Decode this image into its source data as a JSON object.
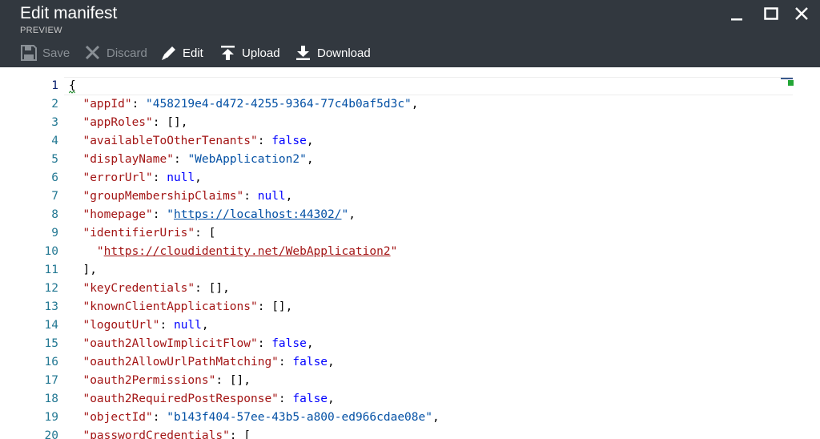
{
  "window": {
    "title": "Edit manifest",
    "subtitle": "PREVIEW",
    "controls": [
      "minimize-icon",
      "maximize-icon",
      "close-icon"
    ]
  },
  "toolbar": {
    "save_label": "Save",
    "discard_label": "Discard",
    "edit_label": "Edit",
    "upload_label": "Upload",
    "download_label": "Download"
  },
  "editor": {
    "lines": [
      {
        "n": "1"
      },
      {
        "n": "2",
        "key": "\"appId\"",
        "sep": ": ",
        "val": "\"458219e4-d472-4255-9364-77c4b0af5d3c\"",
        "vtype": "s",
        "end": ","
      },
      {
        "n": "3",
        "key": "\"appRoles\"",
        "sep": ": ",
        "val": "[]",
        "vtype": "p",
        "end": ","
      },
      {
        "n": "4",
        "key": "\"availableToOtherTenants\"",
        "sep": ": ",
        "val": "false",
        "vtype": "kw",
        "end": ","
      },
      {
        "n": "5",
        "key": "\"displayName\"",
        "sep": ": ",
        "val": "\"WebApplication2\"",
        "vtype": "s",
        "end": ","
      },
      {
        "n": "6",
        "key": "\"errorUrl\"",
        "sep": ": ",
        "val": "null",
        "vtype": "kw",
        "end": ","
      },
      {
        "n": "7",
        "key": "\"groupMembershipClaims\"",
        "sep": ": ",
        "val": "null",
        "vtype": "kw",
        "end": ","
      },
      {
        "n": "8",
        "key": "\"homepage\"",
        "sep": ": ",
        "val": "\"https://localhost:44302/\"",
        "vtype": "s",
        "end": ","
      },
      {
        "n": "9",
        "key": "\"identifierUris\"",
        "sep": ": ",
        "val": "[",
        "vtype": "p",
        "end": ""
      },
      {
        "n": "10",
        "val": "\"https://cloudidentity.net/WebApplication2\"",
        "vtype": "k"
      },
      {
        "n": "11",
        "val": "],",
        "vtype": "p"
      },
      {
        "n": "12",
        "key": "\"keyCredentials\"",
        "sep": ": ",
        "val": "[]",
        "vtype": "p",
        "end": ","
      },
      {
        "n": "13",
        "key": "\"knownClientApplications\"",
        "sep": ": ",
        "val": "[]",
        "vtype": "p",
        "end": ","
      },
      {
        "n": "14",
        "key": "\"logoutUrl\"",
        "sep": ": ",
        "val": "null",
        "vtype": "kw",
        "end": ","
      },
      {
        "n": "15",
        "key": "\"oauth2AllowImplicitFlow\"",
        "sep": ": ",
        "val": "false",
        "vtype": "kw",
        "end": ","
      },
      {
        "n": "16",
        "key": "\"oauth2AllowUrlPathMatching\"",
        "sep": ": ",
        "val": "false",
        "vtype": "kw",
        "end": ","
      },
      {
        "n": "17",
        "key": "\"oauth2Permissions\"",
        "sep": ": ",
        "val": "[]",
        "vtype": "p",
        "end": ","
      },
      {
        "n": "18",
        "key": "\"oauth2RequiredPostResponse\"",
        "sep": ": ",
        "val": "false",
        "vtype": "kw",
        "end": ","
      },
      {
        "n": "19",
        "key": "\"objectId\"",
        "sep": ": ",
        "val": "\"b143f404-57ee-43b5-a800-ed966cdae08e\"",
        "vtype": "s",
        "end": ","
      },
      {
        "n": "20",
        "key": "\"passwordCredentials\"",
        "sep": ": ",
        "val": "[",
        "vtype": "p",
        "end": ""
      }
    ],
    "open_brace": "{"
  },
  "colors": {
    "titlebar": "#32383f",
    "key": "#a31515",
    "string": "#0451a5",
    "keyword": "#0000ff",
    "line_number": "#237893"
  }
}
